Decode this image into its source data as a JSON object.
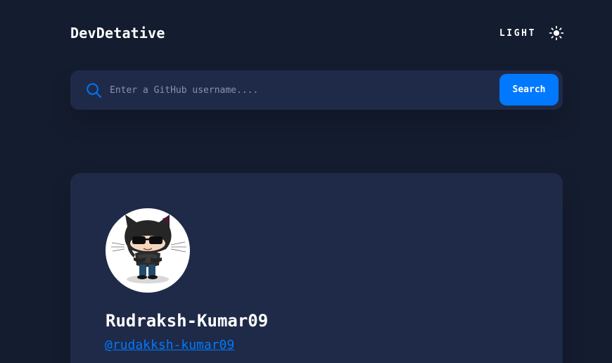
{
  "app": {
    "title": "DevDetative"
  },
  "theme": {
    "label": "LIGHT",
    "icon": "sun-icon"
  },
  "search": {
    "placeholder": "Enter a GitHub username....",
    "value": "",
    "button_label": "Search",
    "icon": "search-icon"
  },
  "profile": {
    "avatar_icon": "octocat-avatar-icon",
    "name": "Rudraksh-Kumar09",
    "handle": "@rudakksh-kumar09"
  },
  "colors": {
    "background": "#141c2f",
    "card": "#1f2a48",
    "accent": "#0079ff",
    "text": "#ffffff",
    "placeholder": "#8a93ab"
  }
}
